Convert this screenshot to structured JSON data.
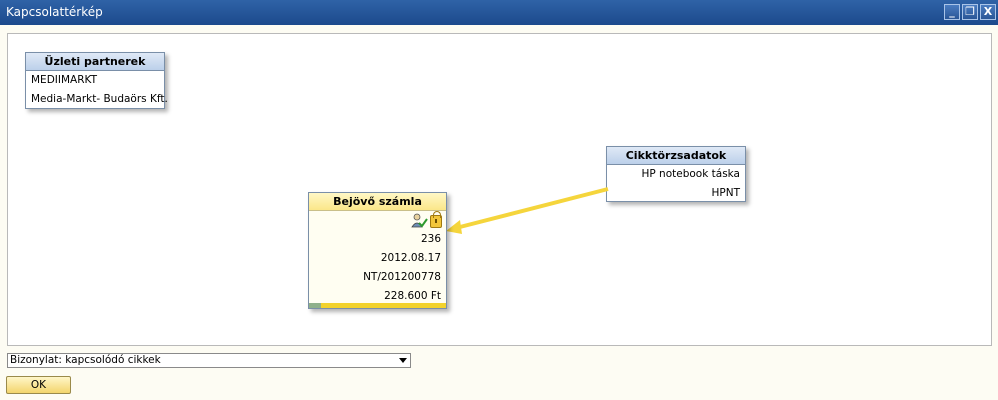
{
  "window": {
    "title": "Kapcsolattérkép",
    "minimize": "_",
    "restore": "❐",
    "close": "X"
  },
  "cards": {
    "business_partners": {
      "header": "Üzleti partnerek",
      "rows": [
        "MEDIIMARKT",
        "Media-Markt- Budaörs Kft."
      ]
    },
    "item_master": {
      "header": "Cikktörzsadatok",
      "rows": [
        "HP notebook táska",
        "HPNT"
      ]
    },
    "incoming_invoice": {
      "header": "Bejövő számla",
      "rows": [
        "236",
        "2012.08.17",
        "NT/201200778",
        "228.600 Ft"
      ],
      "icons": [
        "approved-person-icon",
        "lock-icon"
      ],
      "progress_fraction": 0.09
    }
  },
  "colors": {
    "arrow": "#f5d53c",
    "title_bar": "#2a5a9e"
  },
  "footer": {
    "document_select_value": "Bizonylat: kapcsolódó cikkek",
    "ok_label": "OK"
  }
}
